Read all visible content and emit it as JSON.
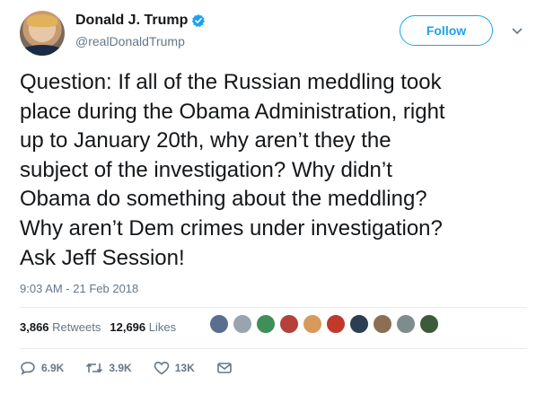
{
  "author": {
    "name": "Donald J. Trump",
    "handle": "@realDonaldTrump"
  },
  "follow_label": "Follow",
  "tweet": {
    "lines": [
      "Question: If all of the Russian meddling took",
      "place during the Obama Administration, right",
      "up to January 20th, why aren’t they the",
      "subject of the investigation? Why didn’t",
      "Obama do something about the meddling?",
      "Why aren’t Dem crimes under investigation?",
      "Ask Jeff Session!"
    ],
    "timestamp": "9:03 AM - 21 Feb 2018"
  },
  "stats": {
    "retweets_count": "3,866",
    "retweets_label": "Retweets",
    "likes_count": "12,696",
    "likes_label": "Likes"
  },
  "likers": [
    "#5a6f8f",
    "#9aa4ae",
    "#3f8f5a",
    "#b4423a",
    "#d89a5a",
    "#c0392b",
    "#2c3e50",
    "#8e6e53",
    "#7f8c8d",
    "#3d5a3a"
  ],
  "actions": {
    "replies": "6.9K",
    "retweets": "3.9K",
    "likes": "13K"
  },
  "colors": {
    "accent": "#1da1f2",
    "muted": "#657786",
    "text": "#14171a"
  }
}
